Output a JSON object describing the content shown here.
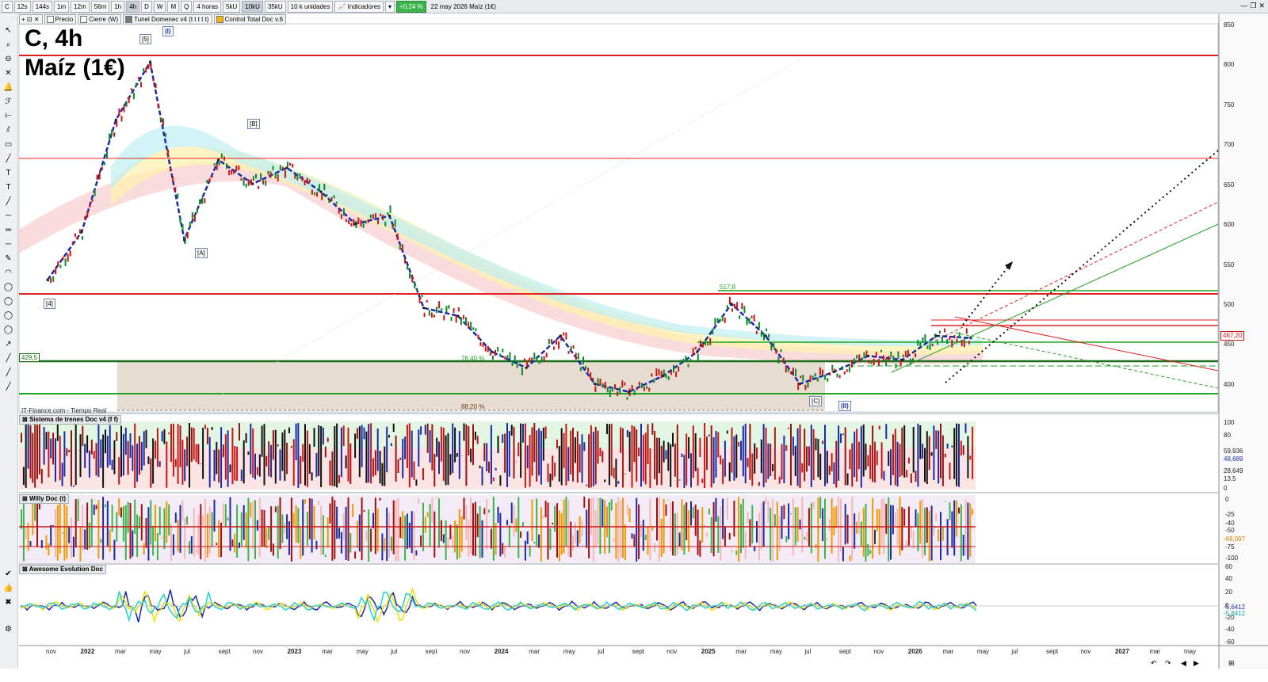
{
  "toolbar": {
    "symbol": "C",
    "timeframes": [
      "12s",
      "144s",
      "1m",
      "12m",
      "56m",
      "1h",
      "4h",
      "D",
      "W",
      "M",
      "Q"
    ],
    "active_timeframe": "4h",
    "period_select": "4 horas",
    "units": [
      "5kU",
      "10kU",
      "35kU"
    ],
    "active_unit": "10kU",
    "units_select": "10 k unidades",
    "indicators_label": "Indicadores",
    "change": "+0,24 %",
    "date_name": "22 may 2026  Maíz (1€)"
  },
  "legend": {
    "items": [
      "Precio",
      "Cierre (W)",
      "Tunel Domenec v4 (t t t t t)",
      "Control Total Doc v.6"
    ]
  },
  "chart_title": {
    "line1": "C, 4h",
    "line2": "Maíz (1€)"
  },
  "source_label": "IT-Finance.com - Tiempo Real",
  "wave_labels": [
    "[5]",
    "(I)",
    "[B]",
    "[A]",
    "[4]",
    "[C]",
    "(II)"
  ],
  "annotations": {
    "level_517": "517,8",
    "level_429": "429,5",
    "fib_76": "76,40 %",
    "fib_88": "88,20 %"
  },
  "price_axis": {
    "ticks": [
      "850",
      "800",
      "750",
      "700",
      "650",
      "600",
      "550",
      "500",
      "450",
      "400"
    ],
    "current": "467,20"
  },
  "time_axis": {
    "ticks": [
      "nov",
      "2022",
      "mar",
      "may",
      "jul",
      "sept",
      "nov",
      "2023",
      "mar",
      "may",
      "jul",
      "sept",
      "nov",
      "2024",
      "mar",
      "may",
      "jul",
      "sept",
      "nov",
      "2025",
      "mar",
      "may",
      "jul",
      "sept",
      "nov",
      "2026",
      "mar",
      "may",
      "jul",
      "sept",
      "nov",
      "2027",
      "mar",
      "may"
    ]
  },
  "panels": {
    "trenes": {
      "title": "Sistema de trenes Doc v4 (f f)",
      "ticks": [
        "100",
        "80",
        "",
        "0"
      ],
      "values": [
        "59,936",
        "48,689",
        "28,649",
        "13,5"
      ]
    },
    "willy": {
      "title": "Willy Doc (t)",
      "ticks": [
        "0",
        "-25",
        "-40",
        "-50",
        "-75",
        "-100"
      ],
      "value": "-69,097"
    },
    "awesome": {
      "title": "Awesome Evolution Doc",
      "ticks": [
        "60",
        "40",
        "20",
        "0",
        "-20",
        "-40",
        "-60"
      ],
      "values": [
        "-5,6412",
        "-5,6412"
      ]
    }
  },
  "chart_data": {
    "type": "line",
    "title": "C, 4h Maíz (1€)",
    "x": [
      "2021-11",
      "2022-01",
      "2022-03",
      "2022-05",
      "2022-07",
      "2022-09",
      "2022-11",
      "2023-01",
      "2023-03",
      "2023-05",
      "2023-07",
      "2023-09",
      "2023-11",
      "2024-01",
      "2024-03",
      "2024-05",
      "2024-07",
      "2024-09",
      "2024-11",
      "2025-01",
      "2025-03",
      "2025-05",
      "2025-07",
      "2025-09",
      "2025-11",
      "2026-01",
      "2026-03",
      "2026-05"
    ],
    "series": [
      {
        "name": "Precio",
        "values": [
          540,
          600,
          740,
          812,
          590,
          690,
          660,
          680,
          650,
          610,
          620,
          505,
          495,
          450,
          430,
          470,
          410,
          400,
          420,
          450,
          510,
          470,
          410,
          425,
          445,
          440,
          470,
          467.2
        ]
      }
    ],
    "ylim": [
      375,
      860
    ],
    "horizontal_levels": [
      813,
      684,
      517.8,
      515,
      474,
      455,
      429.5,
      388
    ],
    "ylabel": "",
    "xlabel": ""
  },
  "colors": {
    "up": "#0a8a2a",
    "down": "#c81616",
    "ma": "#1a2aa8",
    "level_red": "#e02020",
    "level_green": "#1fa31f",
    "box": "#e6dcd0"
  }
}
